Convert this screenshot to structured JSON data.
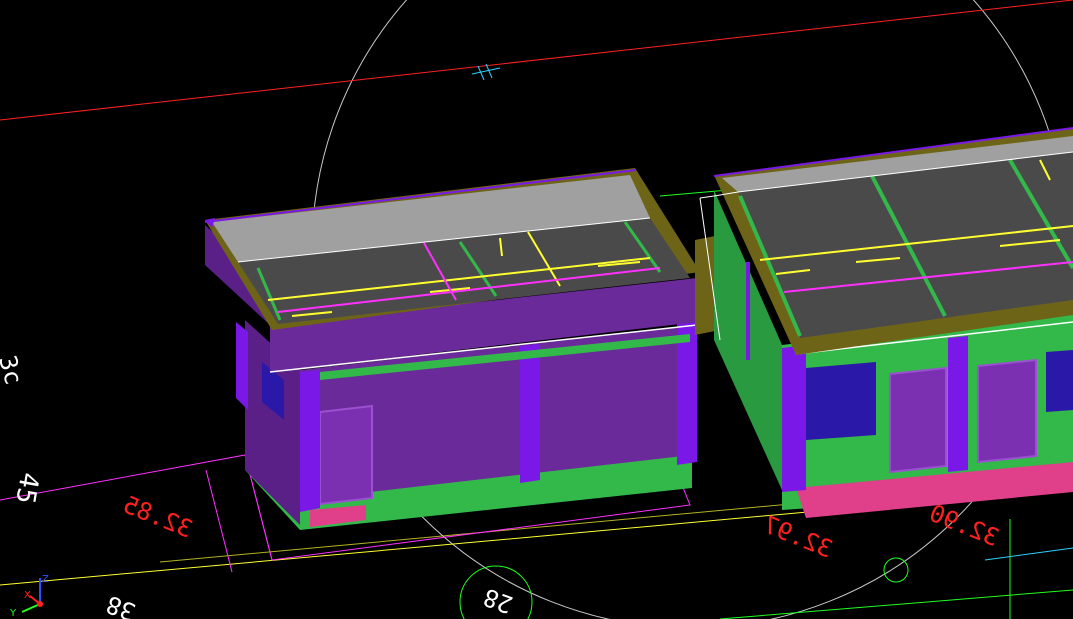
{
  "viewport": {
    "background": "#000000"
  },
  "annotations": {
    "label_left_top": "3c",
    "label_left_mid": "45",
    "label_dim_left": "32.85",
    "label_dim_mid": "32.97",
    "label_dim_right": "32.90",
    "label_bottom_left": "38",
    "label_bottom_circle": "28"
  },
  "axis_triad": {
    "x_label": "X",
    "y_label": "Y",
    "z_label": "Z"
  },
  "colors": {
    "wall_purple": "#6a2a9a",
    "wall_green": "#33b84a",
    "roof_gray": "#4a4a4a",
    "parapet_gray": "#a0a0a0",
    "beam_olive": "#6e6418",
    "column_violet": "#7a18e8",
    "window_blue": "#2a18a8",
    "floor_pink": "#e0408a",
    "line_yellow": "#ffff30",
    "line_magenta": "#ff30ff",
    "line_red": "#ff2020",
    "line_green": "#20ff20",
    "line_cyan": "#30d0ff",
    "line_white": "#ffffff",
    "circle_gray": "#c8c8c8"
  }
}
